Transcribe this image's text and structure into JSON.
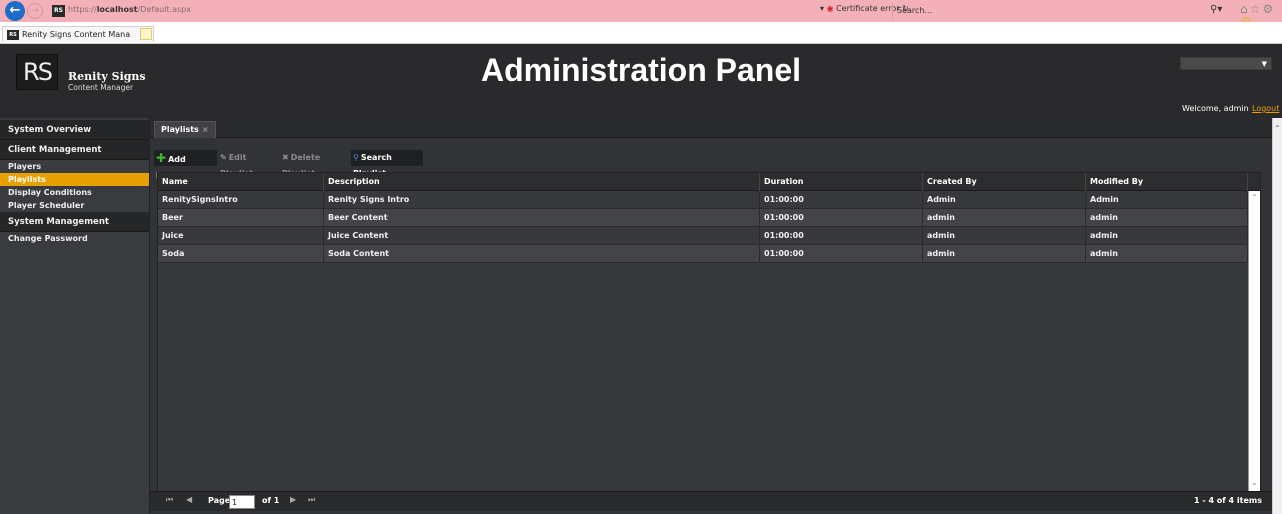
{
  "browser": {
    "url_prefix": "https://",
    "url_host": "localhost",
    "url_path": "/Default.aspx",
    "favicon_text": "RS",
    "cert_error": "Certificate error",
    "search_placeholder": "Search...",
    "tab_title": "Renity Signs Content Mana",
    "tab_close": "×"
  },
  "header": {
    "logo_text": "RS",
    "brand_name": "Renity Signs",
    "brand_sub": "Content Manager",
    "title": "Administration Panel",
    "welcome": "Welcome, admin",
    "logout": "Logout"
  },
  "sidebar": {
    "items": [
      {
        "label": "System Overview",
        "type": "section"
      },
      {
        "label": "Client Management",
        "type": "section"
      },
      {
        "label": "Players",
        "type": "item"
      },
      {
        "label": "Playlists",
        "type": "active"
      },
      {
        "label": "Display Conditions",
        "type": "item"
      },
      {
        "label": "Player Scheduler",
        "type": "item"
      },
      {
        "label": "System Management",
        "type": "section"
      },
      {
        "label": "Change Password",
        "type": "item"
      }
    ]
  },
  "main": {
    "tab_label": "Playlists",
    "tab_close": "×",
    "toolbar": {
      "add": "Add Playlist",
      "edit": "Edit Playlist",
      "delete": "Delete Playlist",
      "search": "Search Playlist"
    },
    "columns": [
      "Name",
      "Description",
      "Duration",
      "Created By",
      "Modified By"
    ],
    "rows": [
      [
        "RenitySignsIntro",
        "Renity Signs Intro",
        "01:00:00",
        "Admin",
        "Admin"
      ],
      [
        "Beer",
        "Beer Content",
        "01:00:00",
        "admin",
        "admin"
      ],
      [
        "Juice",
        "Juice Content",
        "01:00:00",
        "admin",
        "admin"
      ],
      [
        "Soda",
        "Soda Content",
        "01:00:00",
        "admin",
        "admin"
      ]
    ],
    "pager": {
      "page_label": "Page",
      "page_value": "1",
      "of_label": "of 1",
      "info": "1 - 4 of 4 items"
    }
  },
  "colors": {
    "accent": "#e8a000",
    "header_bg": "#2a2a2c",
    "panel_bg": "#323336",
    "add_icon": "#3dba2a"
  }
}
